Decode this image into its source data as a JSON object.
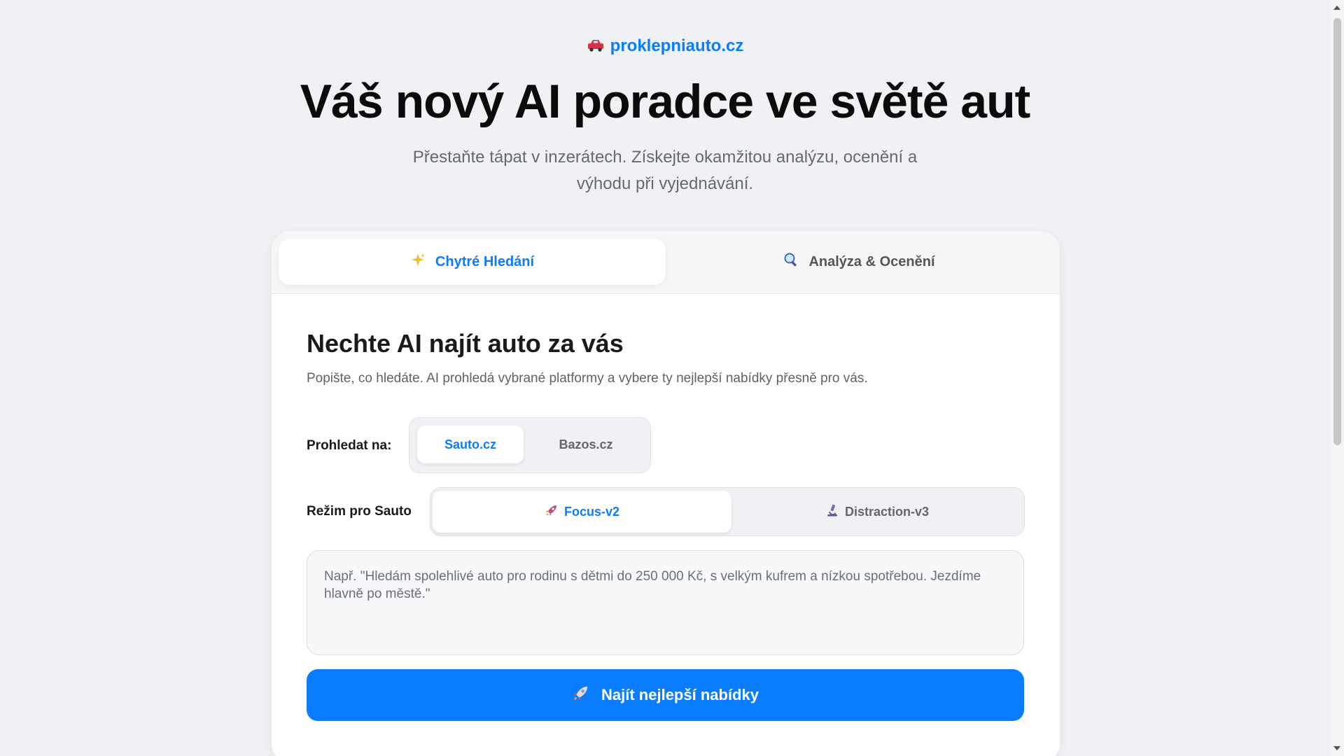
{
  "brand": {
    "icon": "car-icon",
    "name": "proklepniauto.cz",
    "color": "#0a7cff"
  },
  "hero": {
    "title": "Váš nový AI poradce ve světě aut",
    "subtitle": "Přestaňte tápat v inzerátech. Získejte okamžitou analýzu, ocenění a výhodu při vyjednávání."
  },
  "tabs": [
    {
      "icon": "sparkles-icon",
      "label": "Chytré Hledání",
      "active": true
    },
    {
      "icon": "magnifier-icon",
      "label": "Analýza & Ocenění",
      "active": false
    }
  ],
  "search": {
    "title": "Nechte AI najít auto za vás",
    "description": "Popište, co hledáte. AI prohledá vybrané platformy a vybere ty nejlepší nabídky přesně pro vás.",
    "platform_label": "Prohledat na:",
    "platforms": [
      {
        "label": "Sauto.cz",
        "active": true
      },
      {
        "label": "Bazos.cz",
        "active": false
      }
    ],
    "mode_label": "Režim pro Sauto",
    "modes": [
      {
        "icon": "rocket-icon",
        "label": "Focus-v2",
        "active": true
      },
      {
        "icon": "microscope-icon",
        "label": "Distraction-v3",
        "active": false
      }
    ],
    "query_placeholder": "Např. \"Hledám spolehlivé auto pro rodinu s dětmi do 250 000 Kč, s velkým kufrem a nízkou spotřebou. Jezdíme hlavně po městě.\"",
    "query_value": "",
    "submit_icon": "rocket-icon",
    "submit_label": "Najít nejlepší nabídky"
  },
  "colors": {
    "accent": "#0a7cff",
    "background": "#f0f1f5"
  }
}
